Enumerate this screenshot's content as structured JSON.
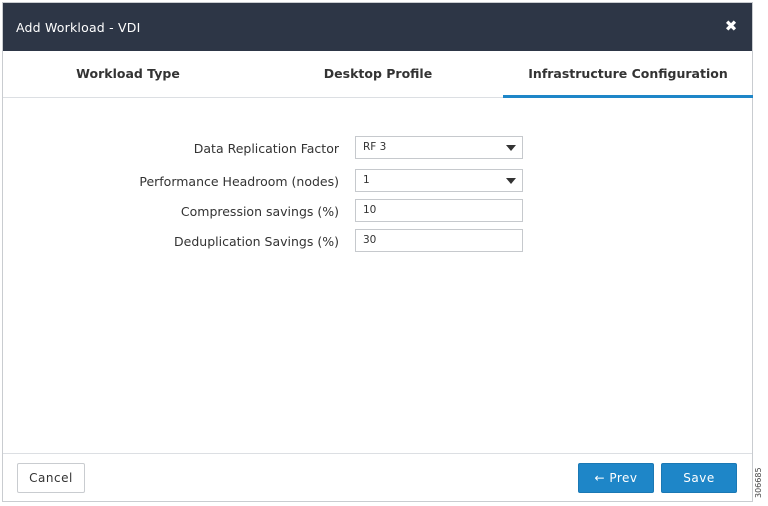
{
  "dialog": {
    "title": "Add Workload - VDI",
    "close_icon": "close-icon",
    "close_glyph": "✖"
  },
  "tabs": [
    {
      "label": "Workload Type",
      "active": false
    },
    {
      "label": "Desktop Profile",
      "active": false
    },
    {
      "label": "Infrastructure Configuration",
      "active": true
    }
  ],
  "form": {
    "data_replication_factor": {
      "label": "Data Replication Factor",
      "value": "RF 3",
      "type": "select"
    },
    "performance_headroom": {
      "label": "Performance Headroom (nodes)",
      "value": "1",
      "type": "select"
    },
    "compression_savings": {
      "label": "Compression savings (%)",
      "value": "10",
      "type": "text"
    },
    "deduplication_savings": {
      "label": "Deduplication Savings (%)",
      "value": "30",
      "type": "text"
    }
  },
  "footer": {
    "cancel_label": "Cancel",
    "prev_label": "← Prev",
    "save_label": "Save"
  },
  "figure_id": "306685",
  "colors": {
    "titlebar": "#2d3646",
    "accent": "#1e86c8",
    "border": "#c9ccd0"
  }
}
